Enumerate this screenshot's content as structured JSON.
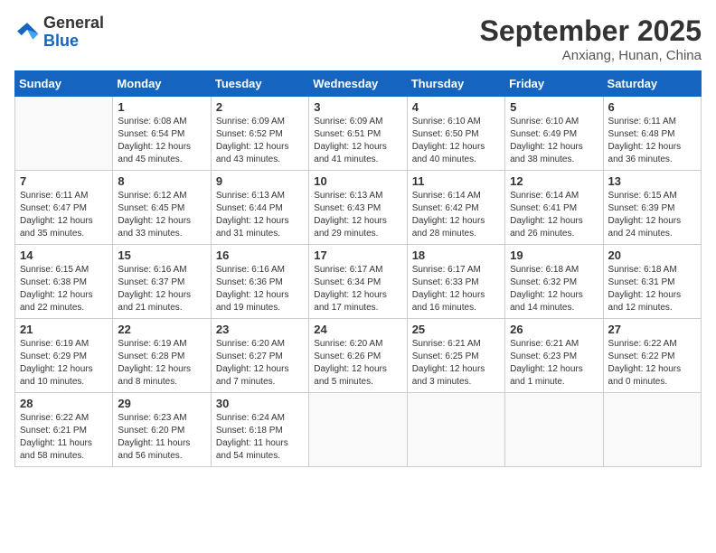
{
  "header": {
    "logo_general": "General",
    "logo_blue": "Blue",
    "month_title": "September 2025",
    "location": "Anxiang, Hunan, China"
  },
  "days_of_week": [
    "Sunday",
    "Monday",
    "Tuesday",
    "Wednesday",
    "Thursday",
    "Friday",
    "Saturday"
  ],
  "weeks": [
    [
      {
        "day": "",
        "sunrise": "",
        "sunset": "",
        "daylight": ""
      },
      {
        "day": "1",
        "sunrise": "Sunrise: 6:08 AM",
        "sunset": "Sunset: 6:54 PM",
        "daylight": "Daylight: 12 hours and 45 minutes."
      },
      {
        "day": "2",
        "sunrise": "Sunrise: 6:09 AM",
        "sunset": "Sunset: 6:52 PM",
        "daylight": "Daylight: 12 hours and 43 minutes."
      },
      {
        "day": "3",
        "sunrise": "Sunrise: 6:09 AM",
        "sunset": "Sunset: 6:51 PM",
        "daylight": "Daylight: 12 hours and 41 minutes."
      },
      {
        "day": "4",
        "sunrise": "Sunrise: 6:10 AM",
        "sunset": "Sunset: 6:50 PM",
        "daylight": "Daylight: 12 hours and 40 minutes."
      },
      {
        "day": "5",
        "sunrise": "Sunrise: 6:10 AM",
        "sunset": "Sunset: 6:49 PM",
        "daylight": "Daylight: 12 hours and 38 minutes."
      },
      {
        "day": "6",
        "sunrise": "Sunrise: 6:11 AM",
        "sunset": "Sunset: 6:48 PM",
        "daylight": "Daylight: 12 hours and 36 minutes."
      }
    ],
    [
      {
        "day": "7",
        "sunrise": "Sunrise: 6:11 AM",
        "sunset": "Sunset: 6:47 PM",
        "daylight": "Daylight: 12 hours and 35 minutes."
      },
      {
        "day": "8",
        "sunrise": "Sunrise: 6:12 AM",
        "sunset": "Sunset: 6:45 PM",
        "daylight": "Daylight: 12 hours and 33 minutes."
      },
      {
        "day": "9",
        "sunrise": "Sunrise: 6:13 AM",
        "sunset": "Sunset: 6:44 PM",
        "daylight": "Daylight: 12 hours and 31 minutes."
      },
      {
        "day": "10",
        "sunrise": "Sunrise: 6:13 AM",
        "sunset": "Sunset: 6:43 PM",
        "daylight": "Daylight: 12 hours and 29 minutes."
      },
      {
        "day": "11",
        "sunrise": "Sunrise: 6:14 AM",
        "sunset": "Sunset: 6:42 PM",
        "daylight": "Daylight: 12 hours and 28 minutes."
      },
      {
        "day": "12",
        "sunrise": "Sunrise: 6:14 AM",
        "sunset": "Sunset: 6:41 PM",
        "daylight": "Daylight: 12 hours and 26 minutes."
      },
      {
        "day": "13",
        "sunrise": "Sunrise: 6:15 AM",
        "sunset": "Sunset: 6:39 PM",
        "daylight": "Daylight: 12 hours and 24 minutes."
      }
    ],
    [
      {
        "day": "14",
        "sunrise": "Sunrise: 6:15 AM",
        "sunset": "Sunset: 6:38 PM",
        "daylight": "Daylight: 12 hours and 22 minutes."
      },
      {
        "day": "15",
        "sunrise": "Sunrise: 6:16 AM",
        "sunset": "Sunset: 6:37 PM",
        "daylight": "Daylight: 12 hours and 21 minutes."
      },
      {
        "day": "16",
        "sunrise": "Sunrise: 6:16 AM",
        "sunset": "Sunset: 6:36 PM",
        "daylight": "Daylight: 12 hours and 19 minutes."
      },
      {
        "day": "17",
        "sunrise": "Sunrise: 6:17 AM",
        "sunset": "Sunset: 6:34 PM",
        "daylight": "Daylight: 12 hours and 17 minutes."
      },
      {
        "day": "18",
        "sunrise": "Sunrise: 6:17 AM",
        "sunset": "Sunset: 6:33 PM",
        "daylight": "Daylight: 12 hours and 16 minutes."
      },
      {
        "day": "19",
        "sunrise": "Sunrise: 6:18 AM",
        "sunset": "Sunset: 6:32 PM",
        "daylight": "Daylight: 12 hours and 14 minutes."
      },
      {
        "day": "20",
        "sunrise": "Sunrise: 6:18 AM",
        "sunset": "Sunset: 6:31 PM",
        "daylight": "Daylight: 12 hours and 12 minutes."
      }
    ],
    [
      {
        "day": "21",
        "sunrise": "Sunrise: 6:19 AM",
        "sunset": "Sunset: 6:29 PM",
        "daylight": "Daylight: 12 hours and 10 minutes."
      },
      {
        "day": "22",
        "sunrise": "Sunrise: 6:19 AM",
        "sunset": "Sunset: 6:28 PM",
        "daylight": "Daylight: 12 hours and 8 minutes."
      },
      {
        "day": "23",
        "sunrise": "Sunrise: 6:20 AM",
        "sunset": "Sunset: 6:27 PM",
        "daylight": "Daylight: 12 hours and 7 minutes."
      },
      {
        "day": "24",
        "sunrise": "Sunrise: 6:20 AM",
        "sunset": "Sunset: 6:26 PM",
        "daylight": "Daylight: 12 hours and 5 minutes."
      },
      {
        "day": "25",
        "sunrise": "Sunrise: 6:21 AM",
        "sunset": "Sunset: 6:25 PM",
        "daylight": "Daylight: 12 hours and 3 minutes."
      },
      {
        "day": "26",
        "sunrise": "Sunrise: 6:21 AM",
        "sunset": "Sunset: 6:23 PM",
        "daylight": "Daylight: 12 hours and 1 minute."
      },
      {
        "day": "27",
        "sunrise": "Sunrise: 6:22 AM",
        "sunset": "Sunset: 6:22 PM",
        "daylight": "Daylight: 12 hours and 0 minutes."
      }
    ],
    [
      {
        "day": "28",
        "sunrise": "Sunrise: 6:22 AM",
        "sunset": "Sunset: 6:21 PM",
        "daylight": "Daylight: 11 hours and 58 minutes."
      },
      {
        "day": "29",
        "sunrise": "Sunrise: 6:23 AM",
        "sunset": "Sunset: 6:20 PM",
        "daylight": "Daylight: 11 hours and 56 minutes."
      },
      {
        "day": "30",
        "sunrise": "Sunrise: 6:24 AM",
        "sunset": "Sunset: 6:18 PM",
        "daylight": "Daylight: 11 hours and 54 minutes."
      },
      {
        "day": "",
        "sunrise": "",
        "sunset": "",
        "daylight": ""
      },
      {
        "day": "",
        "sunrise": "",
        "sunset": "",
        "daylight": ""
      },
      {
        "day": "",
        "sunrise": "",
        "sunset": "",
        "daylight": ""
      },
      {
        "day": "",
        "sunrise": "",
        "sunset": "",
        "daylight": ""
      }
    ]
  ]
}
